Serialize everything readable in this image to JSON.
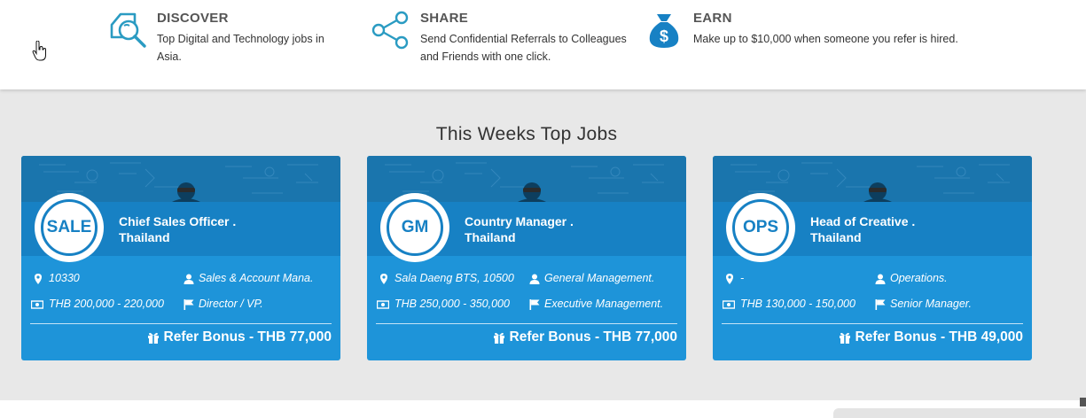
{
  "features": [
    {
      "icon": "search-document-icon",
      "title": "DISCOVER",
      "text": "Top Digital and Technology jobs in Asia."
    },
    {
      "icon": "share-icon",
      "title": "SHARE",
      "text": "Send Confidential Referrals to Colleagues and Friends with one click."
    },
    {
      "icon": "money-bag-icon",
      "title": "EARN",
      "text": "Make up to $10,000 when someone you refer is hired."
    }
  ],
  "section_title": "This Weeks Top Jobs",
  "colors": {
    "accent": "#1e94d9",
    "header_band": "#1781c4",
    "banner": "#1a75ad",
    "icon_teal": "#2a9bc2"
  },
  "jobs": [
    {
      "logo": "SALE",
      "title": "Chief Sales Officer .",
      "location": "Thailand",
      "address": "10330",
      "category": "Sales & Account Mana.",
      "salary": "THB 200,000 - 220,000",
      "level": "Director / VP.",
      "bonus": "Refer Bonus - THB 77,000"
    },
    {
      "logo": "GM",
      "title": "Country Manager .",
      "location": "Thailand",
      "address": "Sala Daeng BTS, 10500",
      "category": "General Management.",
      "salary": "THB 250,000 - 350,000",
      "level": "Executive Management.",
      "bonus": "Refer Bonus - THB 77,000"
    },
    {
      "logo": "OPS",
      "title": "Head of Creative .",
      "location": "Thailand",
      "address": "-",
      "category": "Operations.",
      "salary": "THB 130,000 - 150,000",
      "level": "Senior Manager.",
      "bonus": "Refer Bonus - THB 49,000"
    }
  ]
}
